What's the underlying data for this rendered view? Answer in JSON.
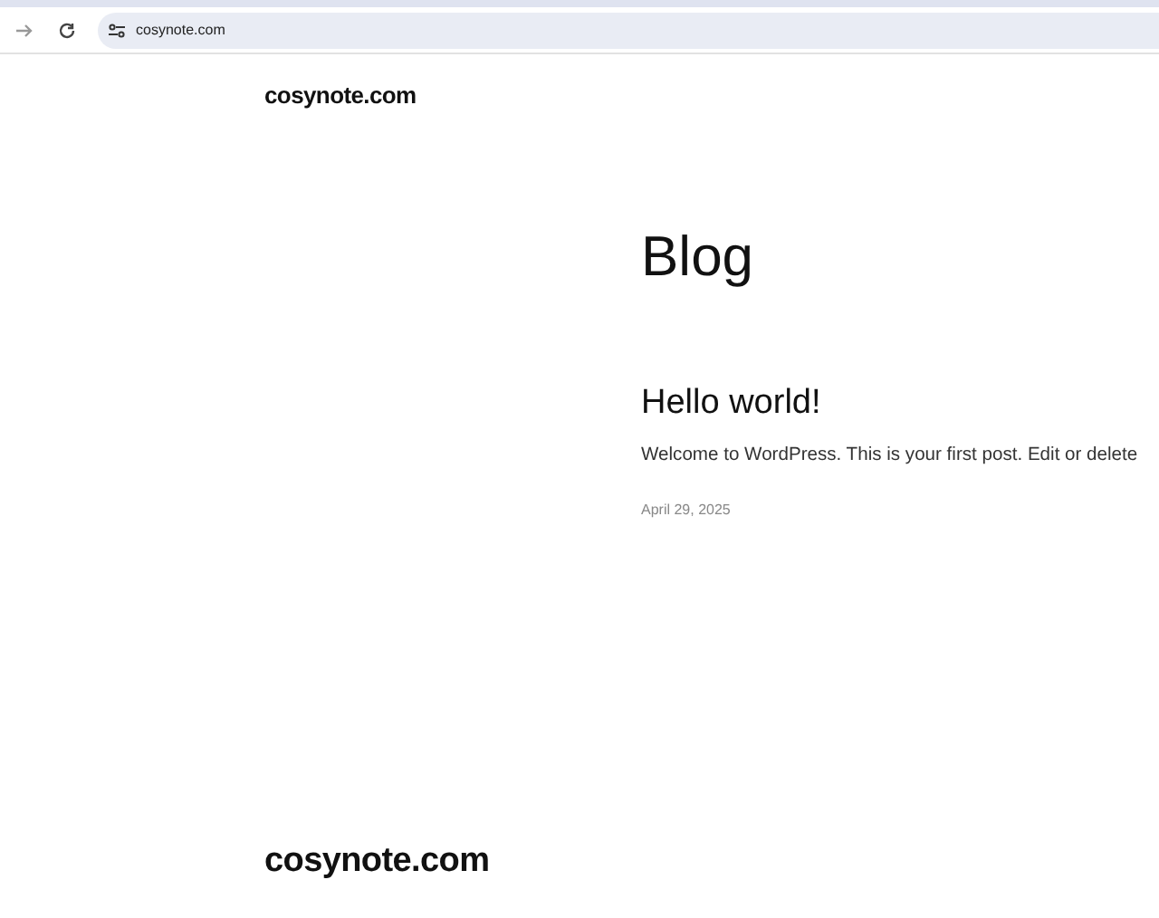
{
  "browser": {
    "address": "cosynote.com"
  },
  "header": {
    "site_title": "cosynote.com"
  },
  "main": {
    "heading": "Blog",
    "posts": [
      {
        "title": "Hello world!",
        "excerpt": "Welcome to WordPress. This is your first post. Edit or delete",
        "date": "April 29, 2025"
      }
    ]
  },
  "footer": {
    "site_title": "cosynote.com"
  }
}
